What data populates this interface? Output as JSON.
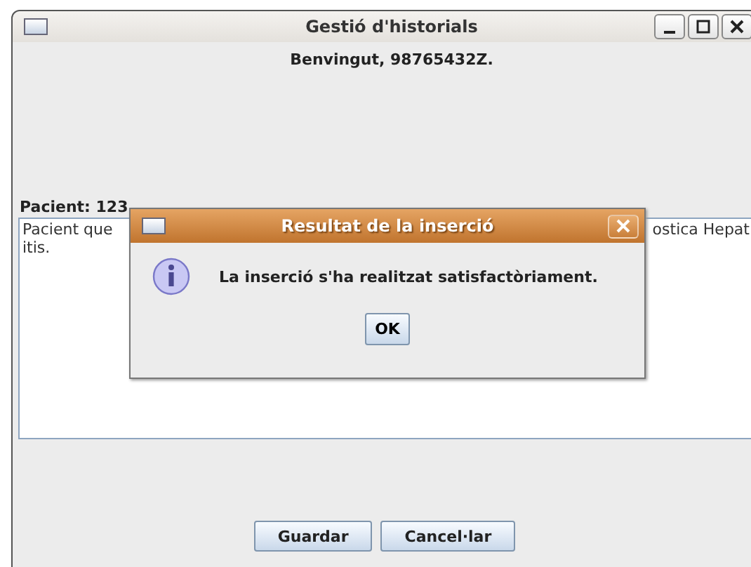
{
  "window": {
    "title": "Gestió d'historials"
  },
  "welcome": "Benvingut, 98765432Z.",
  "patient_label": "Pacient: 123",
  "history": {
    "line_1_start": "Pacient que",
    "line_1_end": "ostica Hepat",
    "line_2": "itis."
  },
  "dialog": {
    "title": "Resultat de la inserció",
    "message": "La inserció s'ha realitzat satisfactòriament.",
    "button": "OK"
  },
  "buttons": [
    "Guardar",
    "Cancel·lar"
  ]
}
